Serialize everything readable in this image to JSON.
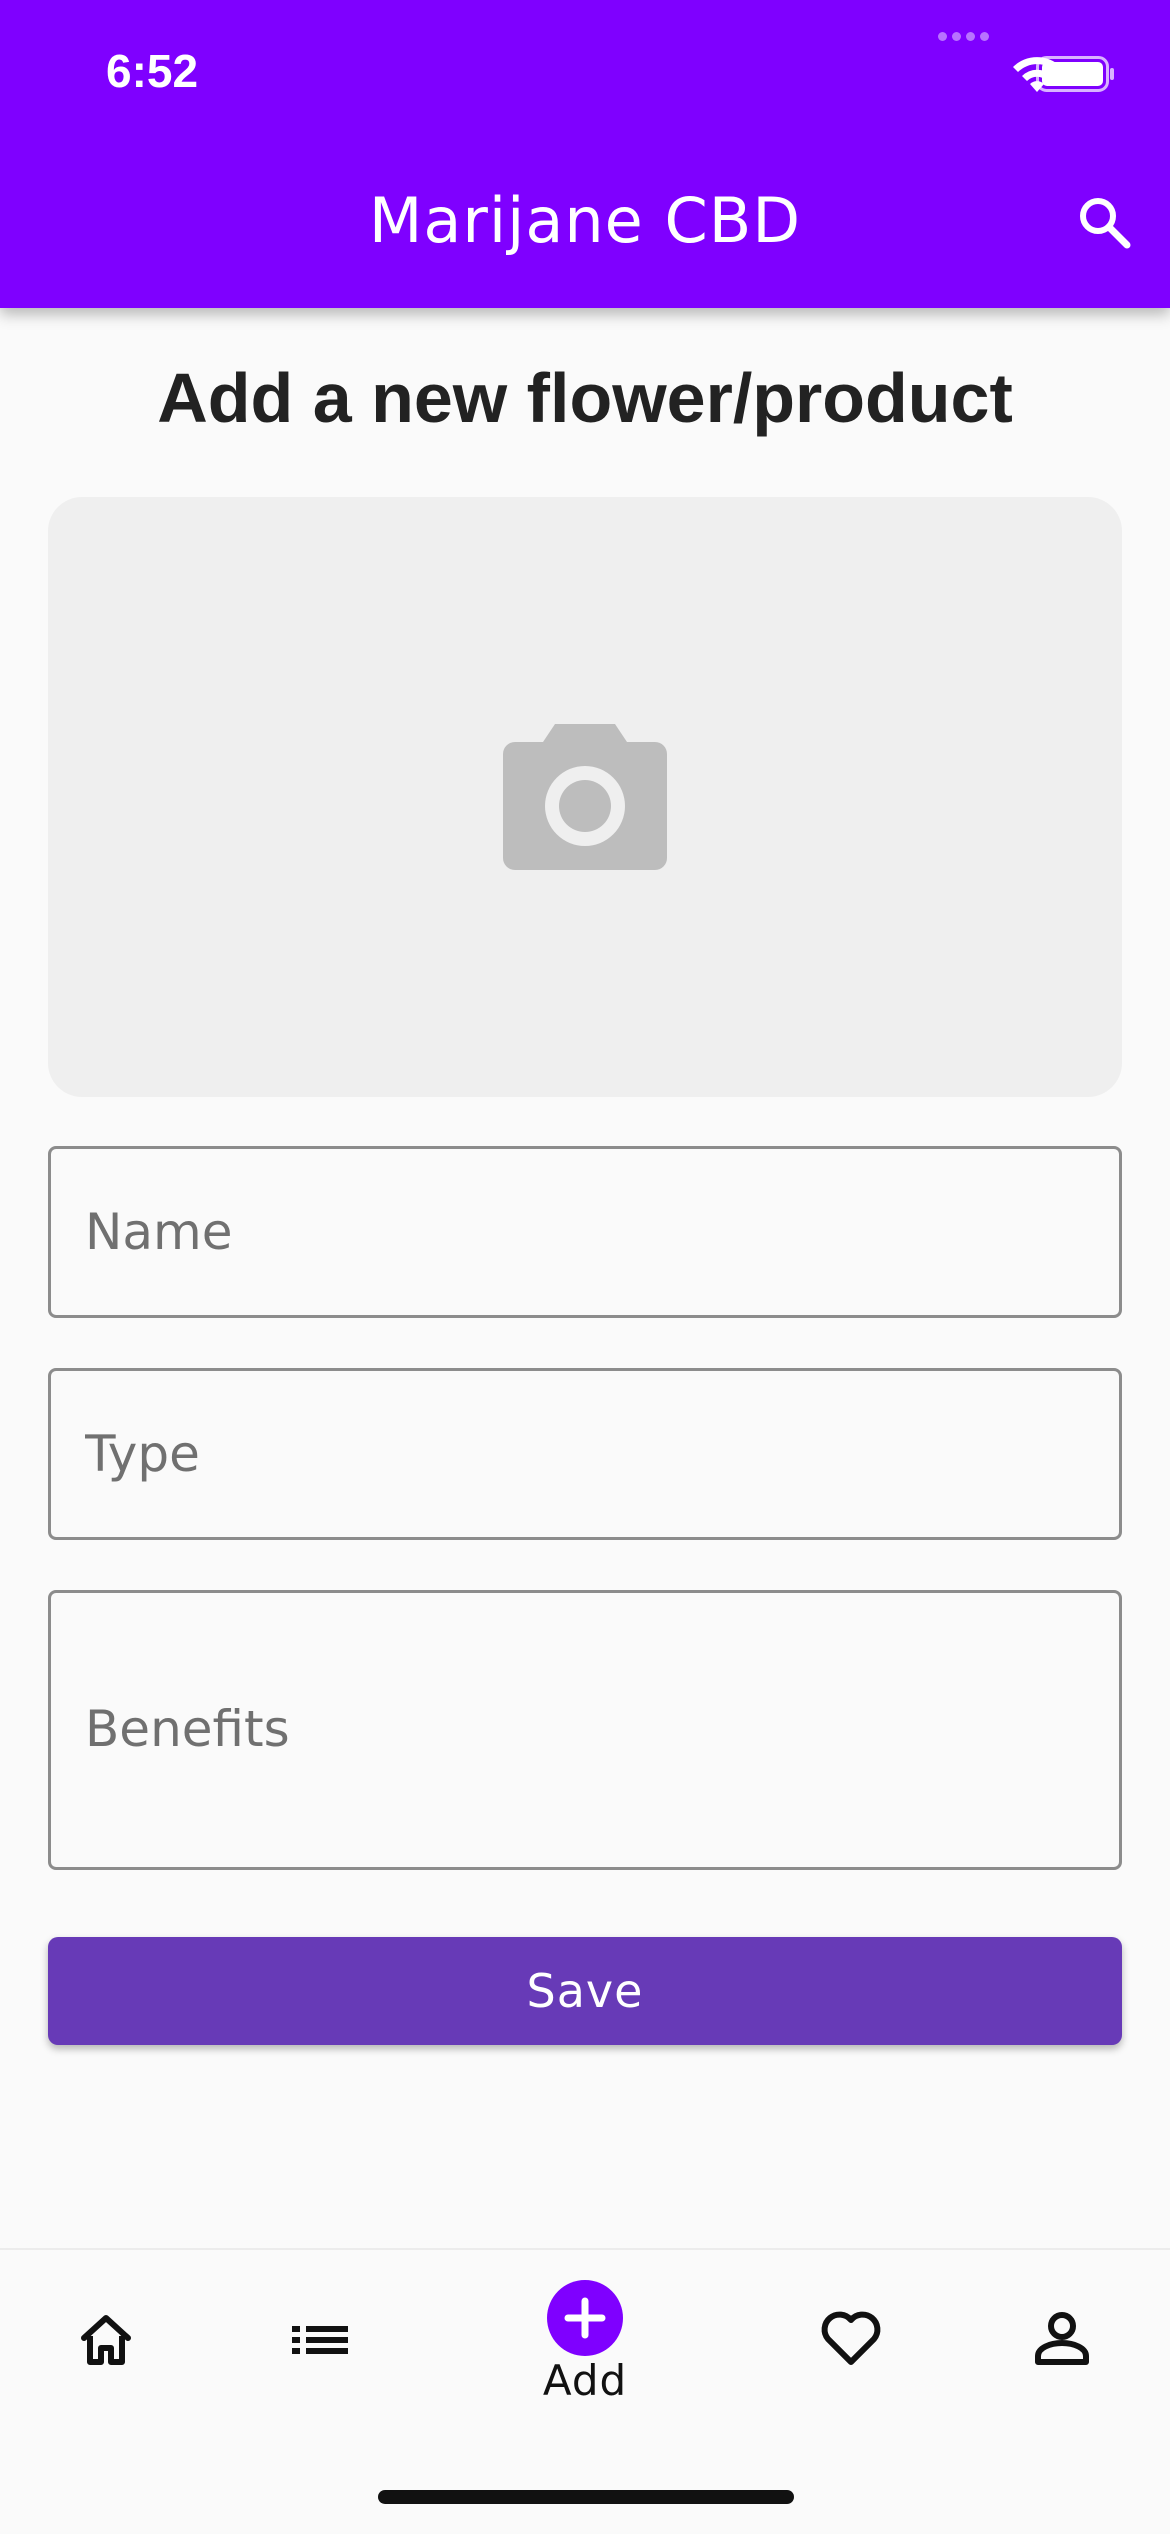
{
  "status_bar": {
    "time": "6:52",
    "wifi_icon": "wifi-icon",
    "battery_icon": "battery-icon"
  },
  "app_bar": {
    "title": "Marijane CBD",
    "search_icon": "search-icon",
    "background_color": "#7f00ff"
  },
  "page": {
    "heading": "Add a new flower/product",
    "image_picker_icon": "camera-icon"
  },
  "form": {
    "name": {
      "placeholder": "Name",
      "value": ""
    },
    "type": {
      "placeholder": "Type",
      "value": ""
    },
    "benefits": {
      "placeholder": "Benefits",
      "value": ""
    },
    "save_label": "Save",
    "save_color": "#673ab7"
  },
  "bottom_nav": {
    "items": [
      {
        "icon": "home-icon",
        "label": ""
      },
      {
        "icon": "list-icon",
        "label": ""
      },
      {
        "icon": "add-circle-icon",
        "label": "Add",
        "active": true
      },
      {
        "icon": "heart-icon",
        "label": ""
      },
      {
        "icon": "profile-icon",
        "label": ""
      }
    ]
  }
}
